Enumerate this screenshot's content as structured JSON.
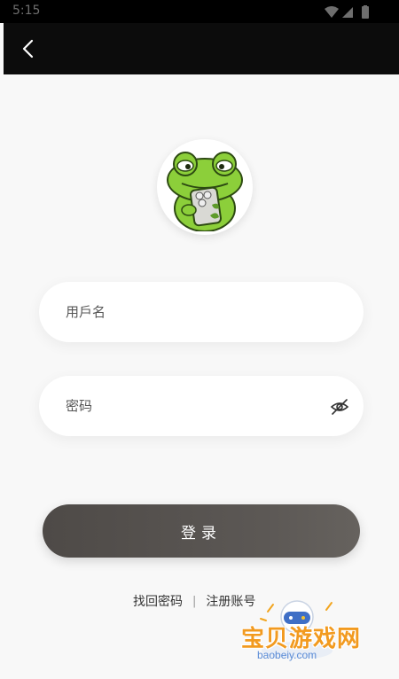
{
  "status_bar": {
    "time": "5:15"
  },
  "login_form": {
    "username_placeholder": "用戶名",
    "password_placeholder": "密码",
    "login_label": "登录"
  },
  "links": {
    "forgot_password": "找回密码",
    "separator": "|",
    "register": "注册账号"
  },
  "watermark": {
    "title": "宝贝游戏网",
    "url": "baobeiy.com"
  },
  "icons": {
    "back": "chevron-left-icon",
    "eye": "eye-off-icon",
    "avatar": "frog-mascot"
  },
  "colors": {
    "app_bar": "#0c0c0c",
    "login_button": "#55514e",
    "page_background": "#f8f8f8",
    "watermark": "#f29a1f"
  }
}
